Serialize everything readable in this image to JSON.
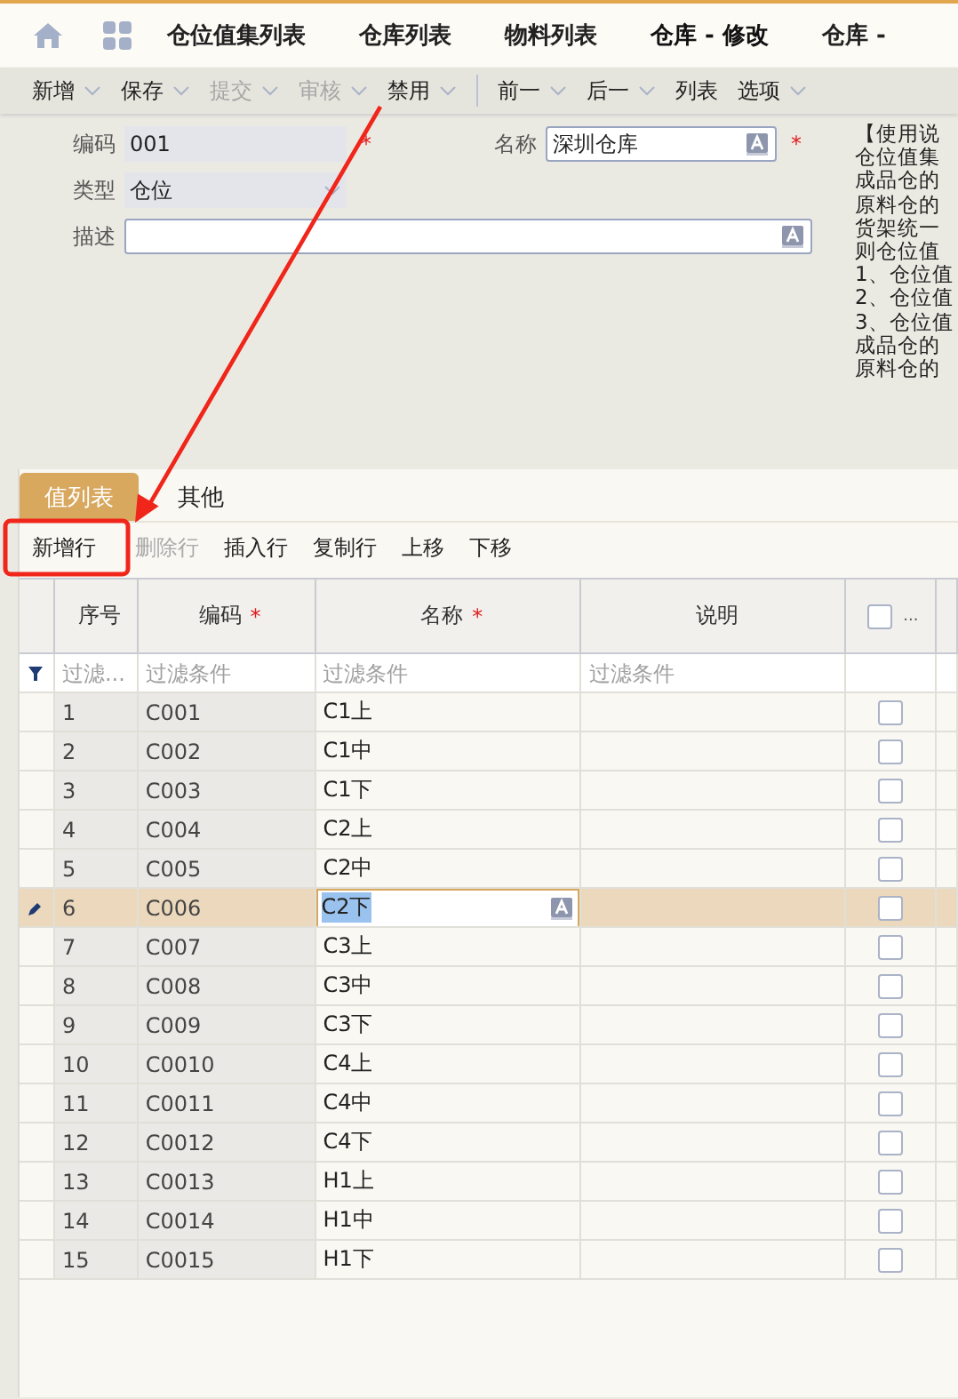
{
  "nav_tabs": [
    {
      "label": "仓位值集列表",
      "selected": false
    },
    {
      "label": "仓库列表",
      "selected": false
    },
    {
      "label": "物料列表",
      "selected": false
    },
    {
      "label": "仓库 - 修改",
      "selected": true
    },
    {
      "label": "仓库 -",
      "selected": false
    }
  ],
  "toolbar": [
    {
      "label": "新增",
      "has_menu": true,
      "disabled": false
    },
    {
      "label": "保存",
      "has_menu": true,
      "disabled": false
    },
    {
      "label": "提交",
      "has_menu": true,
      "disabled": true
    },
    {
      "label": "审核",
      "has_menu": true,
      "disabled": true
    },
    {
      "label": "禁用",
      "has_menu": true,
      "disabled": false
    },
    {
      "label": "前一",
      "has_menu": true,
      "disabled": false
    },
    {
      "label": "后一",
      "has_menu": true,
      "disabled": false
    },
    {
      "label": "列表",
      "has_menu": false,
      "disabled": false
    },
    {
      "label": "选项",
      "has_menu": true,
      "disabled": false
    }
  ],
  "form": {
    "code": {
      "label": "编码",
      "value": "001",
      "required_mark": "*"
    },
    "type": {
      "label": "类型",
      "value": "仓位"
    },
    "name": {
      "label": "名称",
      "value": "深圳仓库",
      "required_mark": "*"
    },
    "description": {
      "label": "描述"
    }
  },
  "help_text": [
    "【使用说",
    "仓位值集",
    "成品仓的",
    "原料仓的",
    "货架统一",
    "则仓位值",
    "1、仓位值",
    "2、仓位值",
    "3、仓位值",
    "成品仓的",
    "原料仓的"
  ],
  "panel_tabs": [
    {
      "label": "值列表",
      "selected": true
    },
    {
      "label": "其他",
      "selected": false
    }
  ],
  "row_actions": [
    {
      "label": "新增行",
      "disabled": false
    },
    {
      "label": "删除行",
      "disabled": true
    },
    {
      "label": "插入行",
      "disabled": false
    },
    {
      "label": "复制行",
      "disabled": false
    },
    {
      "label": "上移",
      "disabled": false
    },
    {
      "label": "下移",
      "disabled": false
    }
  ],
  "table": {
    "columns": [
      {
        "label": "序号"
      },
      {
        "label": "编码",
        "required_mark": "*"
      },
      {
        "label": "名称",
        "required_mark": "*"
      },
      {
        "label": "说明"
      }
    ],
    "header_checkbox": {
      "checked": false,
      "label": "..."
    },
    "filters": [
      {
        "placeholder": "过滤..."
      },
      {
        "placeholder": "过滤条件"
      },
      {
        "placeholder": "过滤条件"
      },
      {
        "placeholder": "过滤条件"
      }
    ],
    "rows": [
      {
        "index": "1",
        "code": "C001",
        "name": "C1上",
        "checked": false,
        "selected": false
      },
      {
        "index": "2",
        "code": "C002",
        "name": "C1中",
        "checked": false,
        "selected": false
      },
      {
        "index": "3",
        "code": "C003",
        "name": "C1下",
        "checked": false,
        "selected": false
      },
      {
        "index": "4",
        "code": "C004",
        "name": "C2上",
        "checked": false,
        "selected": false
      },
      {
        "index": "5",
        "code": "C005",
        "name": "C2中",
        "checked": false,
        "selected": false
      },
      {
        "index": "6",
        "code": "C006",
        "name": "C2下",
        "checked": false,
        "selected": true
      },
      {
        "index": "7",
        "code": "C007",
        "name": "C3上",
        "checked": false,
        "selected": false
      },
      {
        "index": "8",
        "code": "C008",
        "name": "C3中",
        "checked": false,
        "selected": false
      },
      {
        "index": "9",
        "code": "C009",
        "name": "C3下",
        "checked": false,
        "selected": false
      },
      {
        "index": "10",
        "code": "C0010",
        "name": "C4上",
        "checked": false,
        "selected": false
      },
      {
        "index": "11",
        "code": "C0011",
        "name": "C4中",
        "checked": false,
        "selected": false
      },
      {
        "index": "12",
        "code": "C0012",
        "name": "C4下",
        "checked": false,
        "selected": false
      },
      {
        "index": "13",
        "code": "C0013",
        "name": "H1上",
        "checked": false,
        "selected": false
      },
      {
        "index": "14",
        "code": "C0014",
        "name": "H1中",
        "checked": false,
        "selected": false
      },
      {
        "index": "15",
        "code": "C0015",
        "name": "H1下",
        "checked": false,
        "selected": false
      }
    ]
  }
}
